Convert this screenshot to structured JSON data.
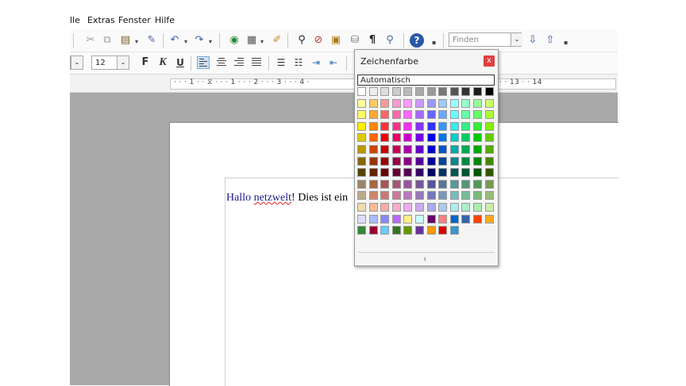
{
  "menu": [
    "lle",
    "Extras",
    "Fenster",
    "Hilfe"
  ],
  "toolbar": {
    "font_size": "12",
    "search_placeholder": "Finden",
    "bold_label": "F",
    "italic_label": "K",
    "underline_label": "U"
  },
  "ruler": {
    "text": "· · · 1 · · ⧖ · · · 1 · · · 2 · · · 3 · · · 4 ·                                             10 · · · 11 · · · 12 · · · 13 · · 14"
  },
  "document": {
    "text_parts": [
      "Hallo ",
      "netzwelt",
      "! Dies ist ein"
    ]
  },
  "color_popup": {
    "title": "Zeichenfarbe",
    "close_label": "x",
    "auto_label": "Automatisch",
    "footer": "ı",
    "rows": [
      [
        "#ffffff",
        "#eeeeee",
        "#dddddd",
        "#cccccc",
        "#bbbbbb",
        "#aaaaaa",
        "#999999",
        "#777777",
        "#555555",
        "#333333",
        "#1c1c1c",
        "#000000"
      ],
      [
        "#ffff99",
        "#ffcc66",
        "#ff9999",
        "#ff99cc",
        "#ff99ff",
        "#cc99ff",
        "#9999ff",
        "#99ccff",
        "#99ffff",
        "#99ffcc",
        "#99ff99",
        "#ccff66"
      ],
      [
        "#ffff66",
        "#ffaa33",
        "#ff6666",
        "#ff66aa",
        "#ff66ff",
        "#aa66ff",
        "#6666ff",
        "#66aaff",
        "#66ffff",
        "#66ffaa",
        "#66ff66",
        "#aaff33"
      ],
      [
        "#ffee00",
        "#ff8800",
        "#ff3333",
        "#ff3388",
        "#ee33ee",
        "#8833ff",
        "#3333ff",
        "#3399ff",
        "#33eeee",
        "#33ee88",
        "#33ee33",
        "#88ee00"
      ],
      [
        "#ddcc00",
        "#ff6600",
        "#ee0000",
        "#ee0066",
        "#cc00cc",
        "#7700ee",
        "#0000ee",
        "#0077ee",
        "#00cccc",
        "#00cc66",
        "#00cc00",
        "#66cc00"
      ],
      [
        "#bb9900",
        "#cc4400",
        "#cc0000",
        "#cc0055",
        "#aa00aa",
        "#6600cc",
        "#0000cc",
        "#0055cc",
        "#00aaaa",
        "#00aa55",
        "#00aa00",
        "#55aa00"
      ],
      [
        "#886600",
        "#993300",
        "#990000",
        "#990044",
        "#880088",
        "#550099",
        "#000099",
        "#004499",
        "#008888",
        "#008844",
        "#008800",
        "#448800"
      ],
      [
        "#554400",
        "#662200",
        "#660000",
        "#660033",
        "#550055",
        "#330066",
        "#000066",
        "#003366",
        "#005555",
        "#005533",
        "#005500",
        "#335500"
      ],
      [
        "#998866",
        "#aa6644",
        "#aa5555",
        "#aa5577",
        "#995599",
        "#775599",
        "#555599",
        "#557799",
        "#559999",
        "#559977",
        "#559955",
        "#779955"
      ],
      [
        "#bbaa88",
        "#cc8866",
        "#cc7777",
        "#cc7799",
        "#bb77bb",
        "#9977bb",
        "#7777bb",
        "#7799bb",
        "#77bbbb",
        "#77bb99",
        "#77bb77",
        "#99bb77"
      ],
      [
        "#eeddaa",
        "#ffbb99",
        "#ffaaaa",
        "#ffaacc",
        "#eeaaee",
        "#ccaaee",
        "#aaaaee",
        "#aaccee",
        "#aaeeee",
        "#aaeecc",
        "#aaeeaa",
        "#cceeaa"
      ],
      [
        "#ddddff",
        "#aabbff",
        "#8888ff",
        "#bb66ff",
        "#ffee88",
        "#ccffff",
        "#660066",
        "#ff8080",
        "#0066cc",
        "#3366aa",
        "#ff4400",
        "#ffaa22"
      ],
      [
        "#338833",
        "#990033",
        "#66ccff",
        "#337722",
        "#669900",
        "#663399",
        "#ff9900",
        "#dd0000",
        "#3399cc"
      ]
    ]
  }
}
